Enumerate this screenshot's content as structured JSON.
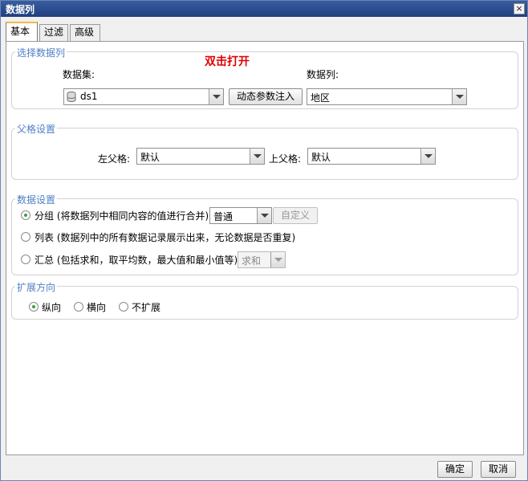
{
  "window": {
    "title": "数据列",
    "close_glyph": "×"
  },
  "tabs": [
    {
      "label": "基本",
      "active": true
    },
    {
      "label": "过滤",
      "active": false
    },
    {
      "label": "高级",
      "active": false
    }
  ],
  "select_column": {
    "legend": "选择数据列",
    "hint": "双击打开",
    "dataset_label": "数据集:",
    "dataset_value": "ds1",
    "dynamic_param_button": "动态参数注入",
    "column_label": "数据列:",
    "column_value": "地区"
  },
  "parent_settings": {
    "legend": "父格设置",
    "left_parent_label": "左父格:",
    "left_parent_value": "默认",
    "top_parent_label": "上父格:",
    "top_parent_value": "默认"
  },
  "data_settings": {
    "legend": "数据设置",
    "options": [
      {
        "label": "分组 (将数据列中相同内容的值进行合并)",
        "checked": true
      },
      {
        "label": "列表 (数据列中的所有数据记录展示出来，无论数据是否重复)",
        "checked": false
      },
      {
        "label": "汇总 (包括求和，取平均数，最大值和最小值等)",
        "checked": false
      }
    ],
    "group_mode_value": "普通",
    "custom_button": "自定义",
    "summary_value": "求和"
  },
  "expand_direction": {
    "legend": "扩展方向",
    "options": [
      {
        "label": "纵向",
        "checked": true
      },
      {
        "label": "横向",
        "checked": false
      },
      {
        "label": "不扩展",
        "checked": false
      }
    ]
  },
  "footer": {
    "ok_label": "确定",
    "cancel_label": "取消"
  }
}
